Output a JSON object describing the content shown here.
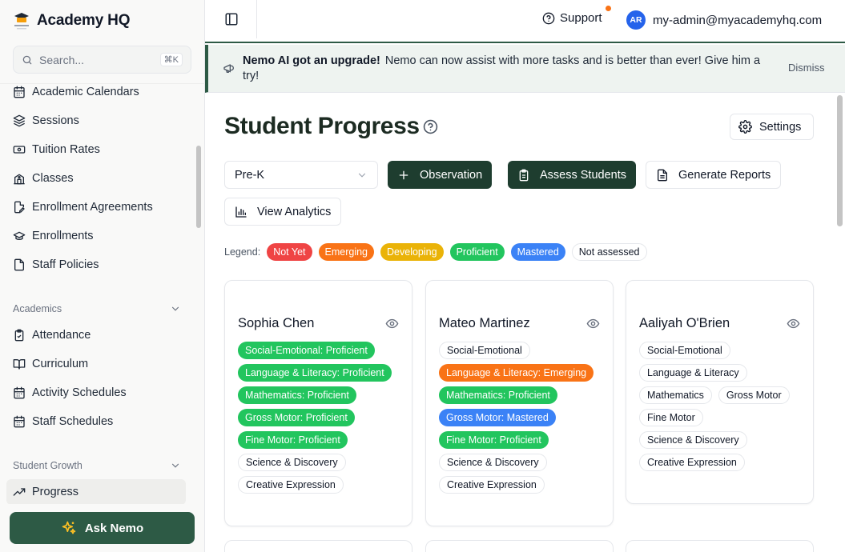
{
  "sidebar": {
    "brand": "Academy HQ",
    "search_placeholder": "Search...",
    "search_shortcut": "⌘K",
    "items_top": [
      {
        "label": "Academic Calendars",
        "icon": "calendar-icon"
      },
      {
        "label": "Sessions",
        "icon": "layers-icon"
      },
      {
        "label": "Tuition Rates",
        "icon": "banknote-icon"
      },
      {
        "label": "Classes",
        "icon": "school-icon"
      },
      {
        "label": "Enrollment Agreements",
        "icon": "file-signature-icon"
      },
      {
        "label": "Enrollments",
        "icon": "graduation-cap-icon"
      },
      {
        "label": "Staff Policies",
        "icon": "file-icon"
      }
    ],
    "section_academics": "Academics",
    "items_academics": [
      {
        "label": "Attendance",
        "icon": "clipboard-check-icon"
      },
      {
        "label": "Curriculum",
        "icon": "book-open-icon"
      },
      {
        "label": "Activity Schedules",
        "icon": "calendar-icon"
      },
      {
        "label": "Staff Schedules",
        "icon": "calendar-icon"
      }
    ],
    "section_growth": "Student Growth",
    "items_growth": [
      {
        "label": "Progress",
        "icon": "trending-up-icon",
        "active": true
      }
    ],
    "ask_label": "Ask Nemo"
  },
  "header": {
    "support_label": "Support",
    "avatar_initials": "AR",
    "user_email": "my-admin@myacademyhq.com"
  },
  "banner": {
    "title": "Nemo AI got an upgrade!",
    "message": "Nemo can now assist with more tasks and is better than ever! Give him a try!",
    "dismiss": "Dismiss"
  },
  "main": {
    "title": "Student Progress",
    "settings_label": "Settings",
    "class_select": "Pre-K",
    "observation_label": "Observation",
    "assess_label": "Assess Students",
    "reports_label": "Generate Reports",
    "analytics_label": "View Analytics",
    "legend_label": "Legend:",
    "legend": [
      {
        "label": "Not Yet",
        "color": "#ef4444"
      },
      {
        "label": "Emerging",
        "color": "#f97316"
      },
      {
        "label": "Developing",
        "color": "#eab308"
      },
      {
        "label": "Proficient",
        "color": "#22c55e"
      },
      {
        "label": "Mastered",
        "color": "#3b82f6"
      },
      {
        "label": "Not assessed",
        "color": "#ffffff"
      }
    ],
    "students": [
      {
        "name": "Sophia Chen",
        "tags": [
          {
            "label": "Social-Emotional: Proficient",
            "color": "#22c55e"
          },
          {
            "label": "Language & Literacy: Proficient",
            "color": "#22c55e"
          },
          {
            "label": "Mathematics: Proficient",
            "color": "#22c55e"
          },
          {
            "label": "Gross Motor: Proficient",
            "color": "#22c55e"
          },
          {
            "label": "Fine Motor: Proficient",
            "color": "#22c55e"
          },
          {
            "label": "Science & Discovery",
            "color": null
          },
          {
            "label": "Creative Expression",
            "color": null
          }
        ]
      },
      {
        "name": "Mateo Martinez",
        "tags": [
          {
            "label": "Social-Emotional",
            "color": null
          },
          {
            "label": "Language & Literacy: Emerging",
            "color": "#f97316"
          },
          {
            "label": "Mathematics: Proficient",
            "color": "#22c55e"
          },
          {
            "label": "Gross Motor: Mastered",
            "color": "#3b82f6"
          },
          {
            "label": "Fine Motor: Proficient",
            "color": "#22c55e"
          },
          {
            "label": "Science & Discovery",
            "color": null
          },
          {
            "label": "Creative Expression",
            "color": null
          }
        ]
      },
      {
        "name": "Aaliyah O'Brien",
        "tags": [
          {
            "label": "Social-Emotional",
            "color": null
          },
          {
            "label": "Language & Literacy",
            "color": null
          },
          {
            "label": "Mathematics",
            "color": null
          },
          {
            "label": "Gross Motor",
            "color": null
          },
          {
            "label": "Fine Motor",
            "color": null
          },
          {
            "label": "Science & Discovery",
            "color": null
          },
          {
            "label": "Creative Expression",
            "color": null
          }
        ]
      }
    ]
  }
}
